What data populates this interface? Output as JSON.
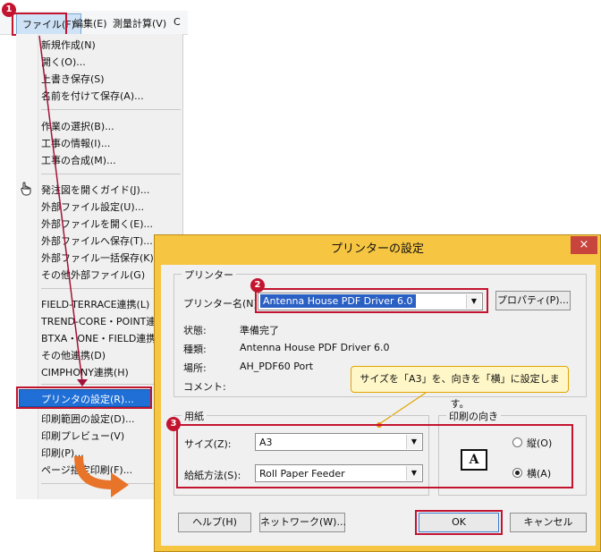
{
  "menubar": {
    "file": "ファイル(F)",
    "edit": "編集(E)",
    "survey": "測量計算(V)",
    "more": "C"
  },
  "menu": {
    "items": [
      "新規作成(N)",
      "開く(O)...",
      "上書き保存(S)",
      "名前を付けて保存(A)...",
      "作業の選択(B)...",
      "工事の情報(I)...",
      "工事の合成(M)...",
      "発注図を開くガイド(J)...",
      "外部ファイル設定(U)...",
      "外部ファイルを開く(E)...",
      "外部ファイルへ保存(T)...",
      "外部ファイル一括保存(K)",
      "その他外部ファイル(G)",
      "FIELD-TERRACE連携(L)",
      "TREND-CORE・POINT連携(R)",
      "BTXA・ONE・FIELD連携(X)",
      "その他連携(D)",
      "CIMPHONY連携(H)",
      "印刷範囲の設定(D)...",
      "印刷プレビュー(V)",
      "印刷(P)...",
      "ページ指定印刷(F)..."
    ],
    "selected": "プリンタの設定(R)..."
  },
  "badges": {
    "one": "1",
    "two": "2",
    "three": "3"
  },
  "dialog": {
    "title": "プリンターの設定",
    "close": "×",
    "printer_group": "プリンター",
    "printer_name_label": "プリンター名(N):",
    "printer_name_value": "Antenna House PDF Driver 6.0",
    "properties_button": "プロパティ(P)...",
    "status_label": "状態:",
    "status_value": "準備完了",
    "type_label": "種類:",
    "type_value": "Antenna House PDF Driver 6.0",
    "location_label": "場所:",
    "location_value": "AH_PDF60 Port",
    "comment_label": "コメント:",
    "paper_group": "用紙",
    "size_label": "サイズ(Z):",
    "size_value": "A3",
    "source_label": "給紙方法(S):",
    "source_value": "Roll Paper Feeder",
    "orientation_group": "印刷の向き",
    "portrait_label": "縦(O)",
    "landscape_label": "横(A)",
    "orientation_icon": "A",
    "help_button": "ヘルプ(H)",
    "network_button": "ネットワーク(W)...",
    "ok_button": "OK",
    "cancel_button": "キャンセル"
  },
  "callout": "サイズを「A3」を、向きを「横」に設定します。",
  "colors": {
    "accent_red": "#c3142f",
    "dialog_frame": "#f6c542",
    "arrow_orange": "#e8742a",
    "menu_highlight": "#1f6fd6"
  }
}
